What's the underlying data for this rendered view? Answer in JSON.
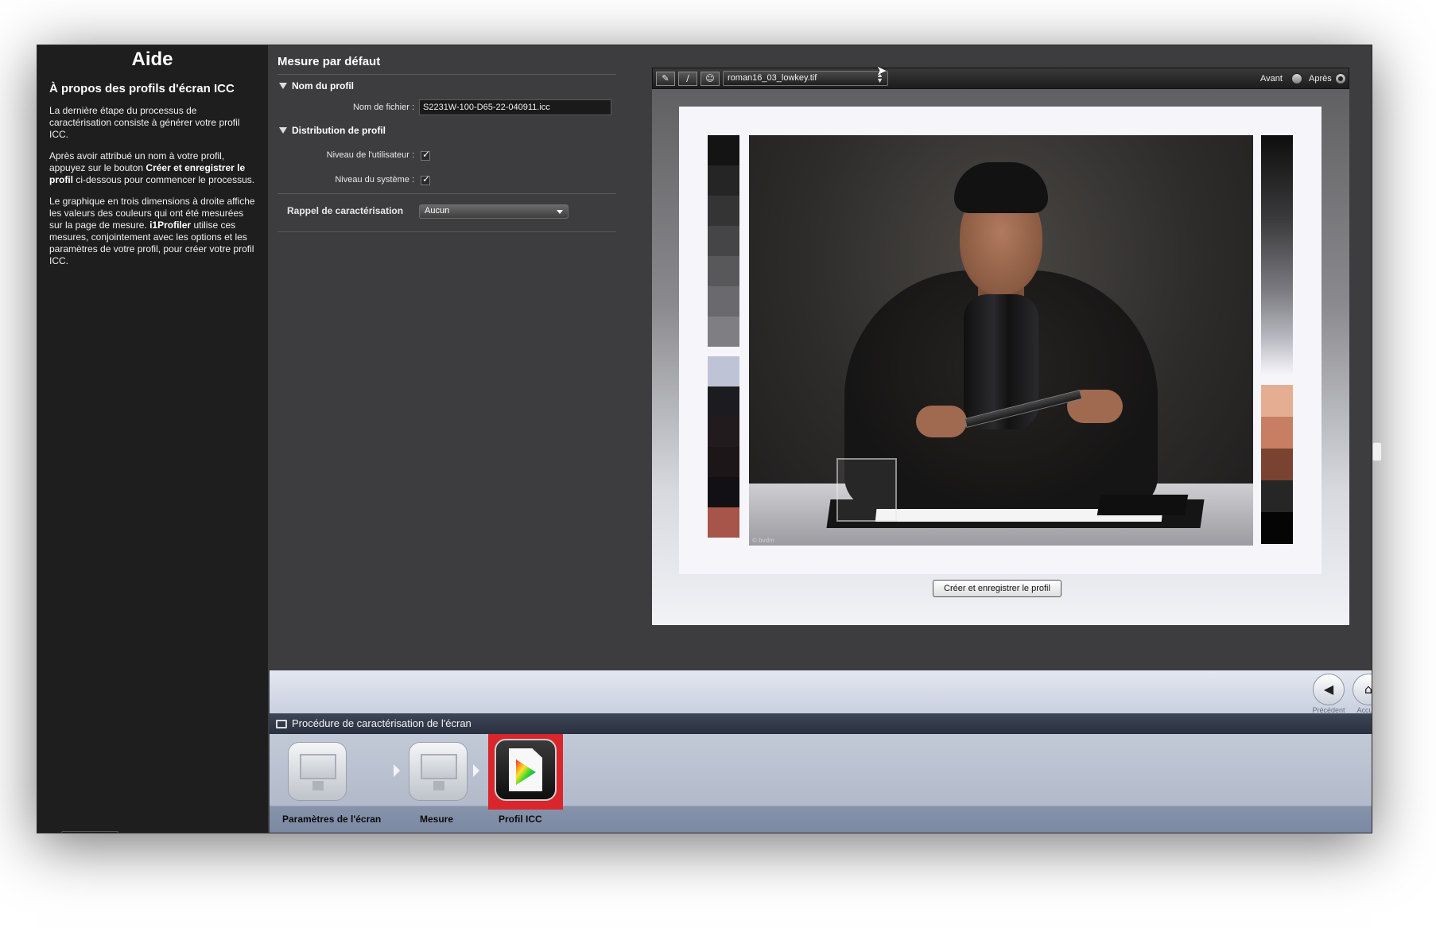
{
  "help": {
    "title": "Aide",
    "subtitle": "À propos des profils d'écran ICC",
    "p1": "La dernière étape du processus de caractérisation consiste à générer votre profil ICC.",
    "p2_pre": "Après avoir attribué un nom à votre profil, appuyez sur le bouton ",
    "p2_bold": "Créer et enregistrer le profil",
    "p2_post": " ci-dessous pour commencer le processus.",
    "p3_pre": "Le graphique en trois dimensions à droite affiche les valeurs des couleurs qui ont été mesurées sur la page de mesure. ",
    "p3_bold": "i1Profiler",
    "p3_post": " utilise ces mesures, conjointement avec les options et les paramètres de votre profil, pour créer votre profil ICC."
  },
  "settings": {
    "title": "Mesure par défaut",
    "profile_name_section": "Nom du profil",
    "filename_label": "Nom de fichier :",
    "filename_value": "S2231W-100-D65-22-040911.icc",
    "distribution_section": "Distribution de profil",
    "user_level_label": "Niveau de l'utilisateur :",
    "user_level_checked": true,
    "system_level_label": "Niveau du système :",
    "system_level_checked": true,
    "reminder_label": "Rappel de caractérisation",
    "reminder_value": "Aucun"
  },
  "preview": {
    "image_file": "roman16_03_lowkey.tif",
    "before_label": "Avant",
    "after_label": "Après",
    "selected": "after",
    "photo_credit": "© bvdm",
    "create_button": "Créer et enregistrer le profil",
    "left_strip_colors": [
      "#141414",
      "#252525",
      "#343434",
      "#454547",
      "#58585b",
      "#6a6a6e",
      "#7e7e83",
      "#bfc3d6",
      "#1c1b20",
      "#211b1e",
      "#1c1618",
      "#121014",
      "#a7544a"
    ],
    "right_strip_colors": [
      "#e5ae92",
      "#c77e62",
      "#7a4230",
      "#262626",
      "#050505"
    ]
  },
  "nav": {
    "previous_label": "Précédent",
    "home_label": "Accueil"
  },
  "workflow": {
    "title": "Procédure de caractérisation de l'écran",
    "steps": [
      {
        "label": "Paramètres de l'écran",
        "active": false
      },
      {
        "label": "Mesure",
        "active": false
      },
      {
        "label": "Profil ICC",
        "active": true
      }
    ]
  }
}
